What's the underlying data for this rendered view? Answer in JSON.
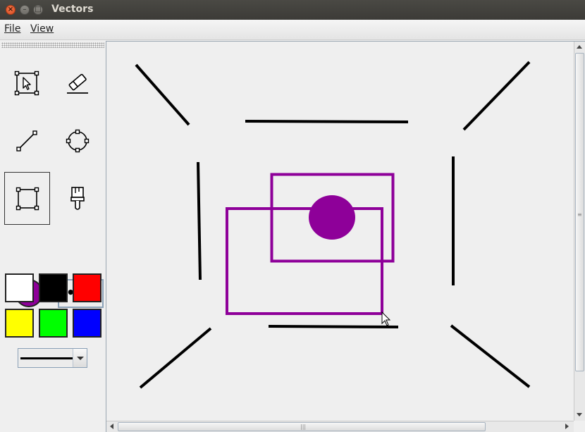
{
  "window": {
    "title": "Vectors"
  },
  "menubar": {
    "items": [
      "File",
      "View"
    ]
  },
  "toolbar": {
    "tools": [
      {
        "name": "select-tool",
        "icon": "select-icon",
        "selected": false
      },
      {
        "name": "eraser-tool",
        "icon": "eraser-icon",
        "selected": false
      },
      {
        "name": "line-tool",
        "icon": "line-icon",
        "selected": false
      },
      {
        "name": "ellipse-tool",
        "icon": "ellipse-icon",
        "selected": false
      },
      {
        "name": "rectangle-tool",
        "icon": "rectangle-icon",
        "selected": true
      },
      {
        "name": "fill-tool",
        "icon": "paintbrush-icon",
        "selected": false
      }
    ],
    "current_color": "#8e0099",
    "more_colors_label": "•••",
    "palette": [
      "#ffffff",
      "#000000",
      "#ff0000",
      "#ffff00",
      "#00ff00",
      "#0000ff"
    ],
    "stroke_width": "thick"
  },
  "canvas": {
    "background": "#efefef",
    "shape_color": "#8e0099",
    "line_color": "#000000"
  }
}
